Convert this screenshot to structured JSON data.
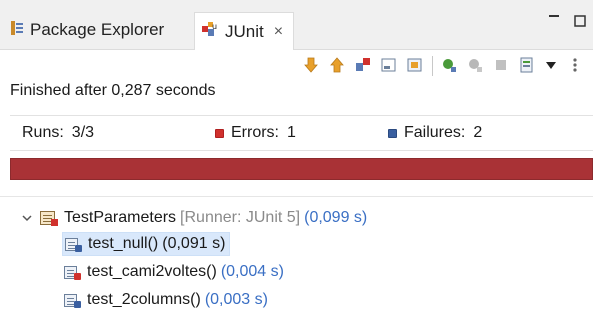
{
  "tabs": [
    {
      "label": "Package Explorer",
      "icon": "package-explorer-icon"
    },
    {
      "label": "JUnit",
      "icon": "junit-icon",
      "close": "×"
    }
  ],
  "window_controls": {
    "minimize": "▭",
    "maximize": "□"
  },
  "toolbar": {
    "buttons": [
      "next-failure-icon",
      "previous-failure-icon",
      "show-failures-only-icon",
      "scroll-lock-icon",
      "show-skipped-icon",
      "rerun-icon",
      "rerun-failed-first-icon",
      "stop-icon",
      "history-icon",
      "view-menu-icon",
      "more-icon"
    ]
  },
  "status": {
    "text": "Finished after 0,287 seconds"
  },
  "counters": {
    "runs_label": "Runs:",
    "runs_value": "3/3",
    "errors_label": "Errors:",
    "errors_value": "1",
    "failures_label": "Failures:",
    "failures_value": "2"
  },
  "progress": {
    "fraction": 1.0,
    "state": "error",
    "color": "#a93236"
  },
  "tree": {
    "root": {
      "name": "TestParameters",
      "runner": "[Runner: JUnit 5]",
      "time": "(0,099 s)"
    },
    "tests": [
      {
        "name": "test_null()",
        "time": "(0,091 s)",
        "status": "failure",
        "selected": true
      },
      {
        "name": "test_cami2voltes()",
        "time": "(0,004 s)",
        "status": "error",
        "selected": false
      },
      {
        "name": "test_2columns()",
        "time": "(0,003 s)",
        "status": "failure",
        "selected": false
      }
    ]
  }
}
